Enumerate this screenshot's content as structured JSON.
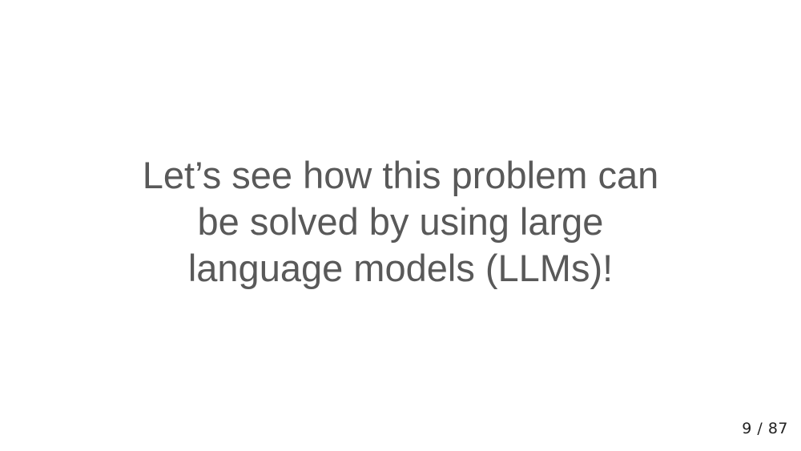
{
  "slide": {
    "lines": [
      "Let’s see how this problem can",
      "be solved by using large",
      "language models (LLMs)!"
    ]
  },
  "footer": {
    "page_counter": "9 / 87"
  }
}
